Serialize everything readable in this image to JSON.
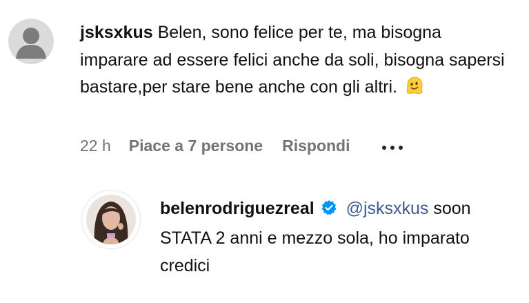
{
  "comment": {
    "username": "jsksxkus",
    "text": "Belen, sono felice per te, ma bisogna imparare ad essere felici anche da soli, bisogna sapersi bastare,per stare bene anche con gli altri.",
    "emoji": "melting-face-emoji",
    "time": "22 h",
    "likes": "Piace a 7 persone",
    "reply": "Rispondi"
  },
  "reply_comment": {
    "username": "belenrodriguezreal",
    "mention": "@jsksxkus",
    "text": "soon STATA 2 anni e mezzo sola, ho imparato credici",
    "verified_color": "#0095f6"
  },
  "colors": {
    "meta": "#737373",
    "mention": "#3f5a92"
  }
}
